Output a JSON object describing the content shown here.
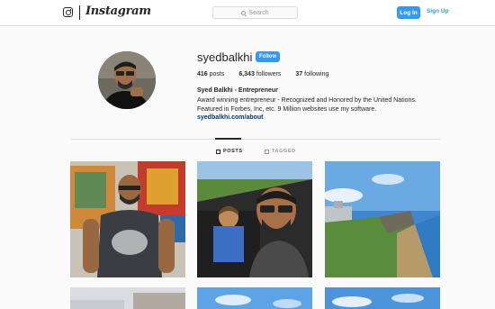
{
  "nav": {
    "brand": "Instagram",
    "search_placeholder": "Search",
    "login_label": "Log In",
    "signup_label": "Sign Up",
    "icons": [
      "instagram-camera-icon",
      "search-icon"
    ]
  },
  "profile": {
    "username": "syedbalkhi",
    "follow_label": "Follow",
    "posts_count": "416",
    "posts_label": "posts",
    "followers_count": "6,343",
    "followers_label": "followers",
    "following_count": "37",
    "following_label": "following",
    "full_name": "Syed Balkhi - Entrepreneur",
    "bio_line1": "Award winning entrepreneur - Recognized and Honored by the United Nations.",
    "bio_line2": "Featured in Forbes, Inc, etc. 9 Million websites use my software.",
    "website": "syedbalkhi.com/about"
  },
  "tabs": [
    {
      "label": "POSTS",
      "active": true,
      "icon": "grid-icon"
    },
    {
      "label": "TAGGED",
      "active": false,
      "icon": "tag-icon"
    }
  ],
  "colors": {
    "accent": "#3897f0",
    "link": "#003569",
    "background": "#fafafa",
    "border": "#dbdbdb"
  },
  "posts": [
    {
      "subject": "man in graphic t-shirt in front of paintings"
    },
    {
      "subject": "selfie with child in car"
    },
    {
      "subject": "coastal fortress landscape"
    },
    {
      "subject": "partial photo"
    },
    {
      "subject": "partial photo"
    },
    {
      "subject": "partial photo"
    }
  ]
}
